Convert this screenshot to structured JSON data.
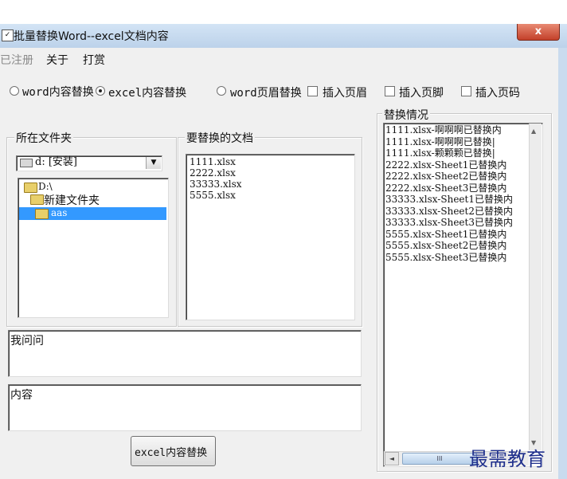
{
  "window": {
    "title": "批量替换Word--excel文档内容",
    "close_label": "x"
  },
  "menu": {
    "items": [
      "已注册",
      "关于",
      "打赏"
    ]
  },
  "options": {
    "radios": [
      "word内容替换",
      "excel内容替换",
      "word页眉替换"
    ],
    "selected": "excel内容替换",
    "checkboxes": [
      "插入页眉",
      "插入页脚",
      "插入页码"
    ]
  },
  "folder_group": {
    "title": "所在文件夹",
    "drive": "d: [安装]",
    "tree": [
      "D:\\",
      "新建文件夹",
      "aas"
    ],
    "selected": "aas"
  },
  "docs_group": {
    "title": "要替换的文档",
    "files": [
      "1111.xlsx",
      "2222.xlsx",
      "33333.xlsx",
      "5555.xlsx"
    ]
  },
  "find_field": {
    "value": "我问问"
  },
  "replace_field": {
    "value": "内容"
  },
  "action_button": {
    "label": "excel内容替换"
  },
  "result_group": {
    "title": "替换情况",
    "lines": [
      "1111.xlsx-啊啊啊已替换内",
      "1111.xlsx-啊啊啊已替换|",
      "1111.xlsx-颗颗颗已替换|",
      "2222.xlsx-Sheet1已替换内",
      "2222.xlsx-Sheet2已替换内",
      "2222.xlsx-Sheet3已替换内",
      "33333.xlsx-Sheet1已替换内",
      "33333.xlsx-Sheet2已替换内",
      "33333.xlsx-Sheet3已替换内",
      "5555.xlsx-Sheet1已替换内",
      "5555.xlsx-Sheet2已替换内",
      "5555.xlsx-Sheet3已替换内"
    ],
    "scroll_thumb_glyph": "III"
  },
  "watermark": {
    "text": "最需教育"
  }
}
